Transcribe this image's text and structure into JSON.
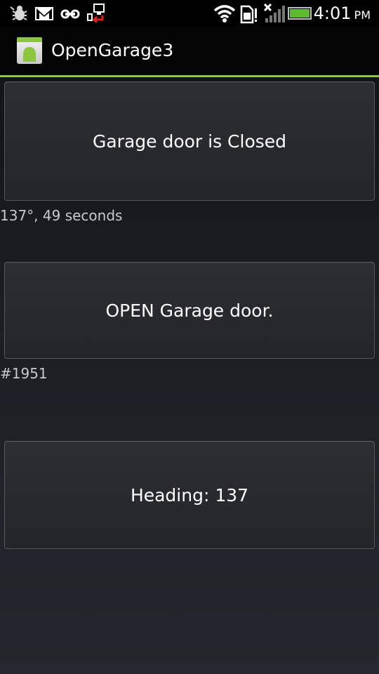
{
  "status_bar": {
    "time": "4:01",
    "ampm": "PM",
    "icons": [
      "usb-debug-icon",
      "gmail-icon",
      "voicemail-icon",
      "screen-share-icon",
      "wifi-icon",
      "sd-card-alert-icon",
      "no-signal-icon",
      "battery-icon"
    ]
  },
  "app": {
    "title": "OpenGarage3",
    "icon": "android-app-icon"
  },
  "main": {
    "door_status_label": "Garage door is Closed",
    "angle_text": "137°, 49 seconds",
    "open_button_label": "OPEN Garage door.",
    "counter_text": "#1951",
    "heading_button_label": "Heading: 137"
  },
  "colors": {
    "accent": "#8cc63f",
    "battery": "#5dbb2f"
  }
}
